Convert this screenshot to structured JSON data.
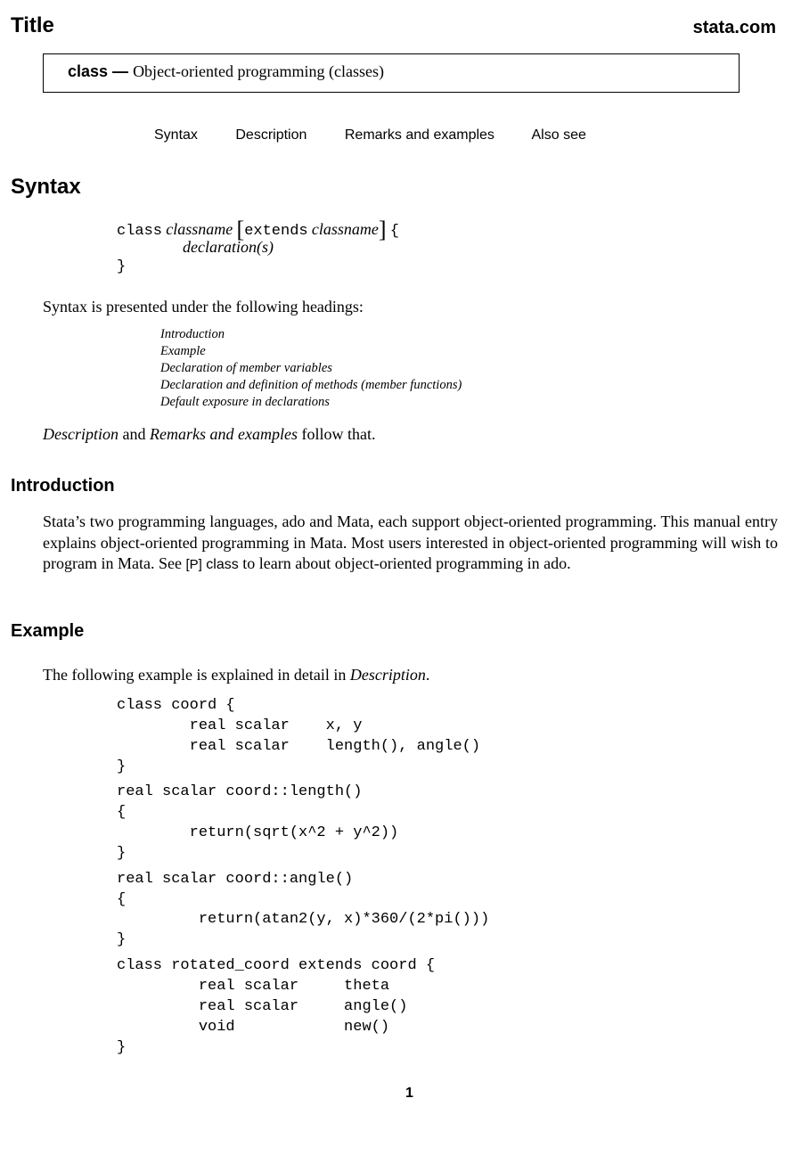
{
  "header": {
    "title": "Title",
    "site": "stata.com"
  },
  "title_box": {
    "command": "class",
    "dash": " — ",
    "description": "Object-oriented programming (classes)"
  },
  "nav": {
    "items": [
      "Syntax",
      "Description",
      "Remarks and examples",
      "Also see"
    ]
  },
  "syntax": {
    "heading": "Syntax",
    "line1": {
      "kw_class": "class",
      "classname": "classname",
      "bracket_open": "[",
      "kw_extends": "extends",
      "classname2": "classname",
      "bracket_close": "]",
      "brace": "{"
    },
    "line2": "declaration(s)",
    "line3": "}",
    "presented_text": "Syntax is presented under the following headings:",
    "headings": [
      "Introduction",
      "Example",
      "Declaration of member variables",
      "Declaration and definition of methods (member functions)",
      "Default exposure in declarations"
    ],
    "follow": {
      "desc": "Description",
      "and": " and ",
      "remarks": "Remarks and examples",
      "rest": " follow that."
    }
  },
  "introduction": {
    "heading": "Introduction",
    "text_before": "Stata’s two programming languages, ado and Mata, each support object-oriented programming. This manual entry explains object-oriented programming in Mata. Most users interested in object-oriented programming will wish to program in Mata. See ",
    "ref_manual": "[P]",
    "ref_cmd": "class",
    "text_after": " to learn about object-oriented programming in ado."
  },
  "example": {
    "heading": "Example",
    "intro_before": "The following example is explained in detail in ",
    "intro_link": "Description",
    "intro_after": ".",
    "code": [
      "class coord {",
      "        real scalar    x, y",
      "        real scalar    length(), angle()",
      "}",
      "real scalar coord::length()",
      "{",
      "        return(sqrt(x^2 + y^2))",
      "}",
      "real scalar coord::angle()",
      "{",
      "         return(atan2(y, x)*360/(2*pi()))",
      "}",
      "class rotated_coord extends coord {",
      "         real scalar     theta",
      "         real scalar     angle()",
      "         void            new()",
      "}"
    ]
  },
  "footer": {
    "page_number": "1"
  }
}
